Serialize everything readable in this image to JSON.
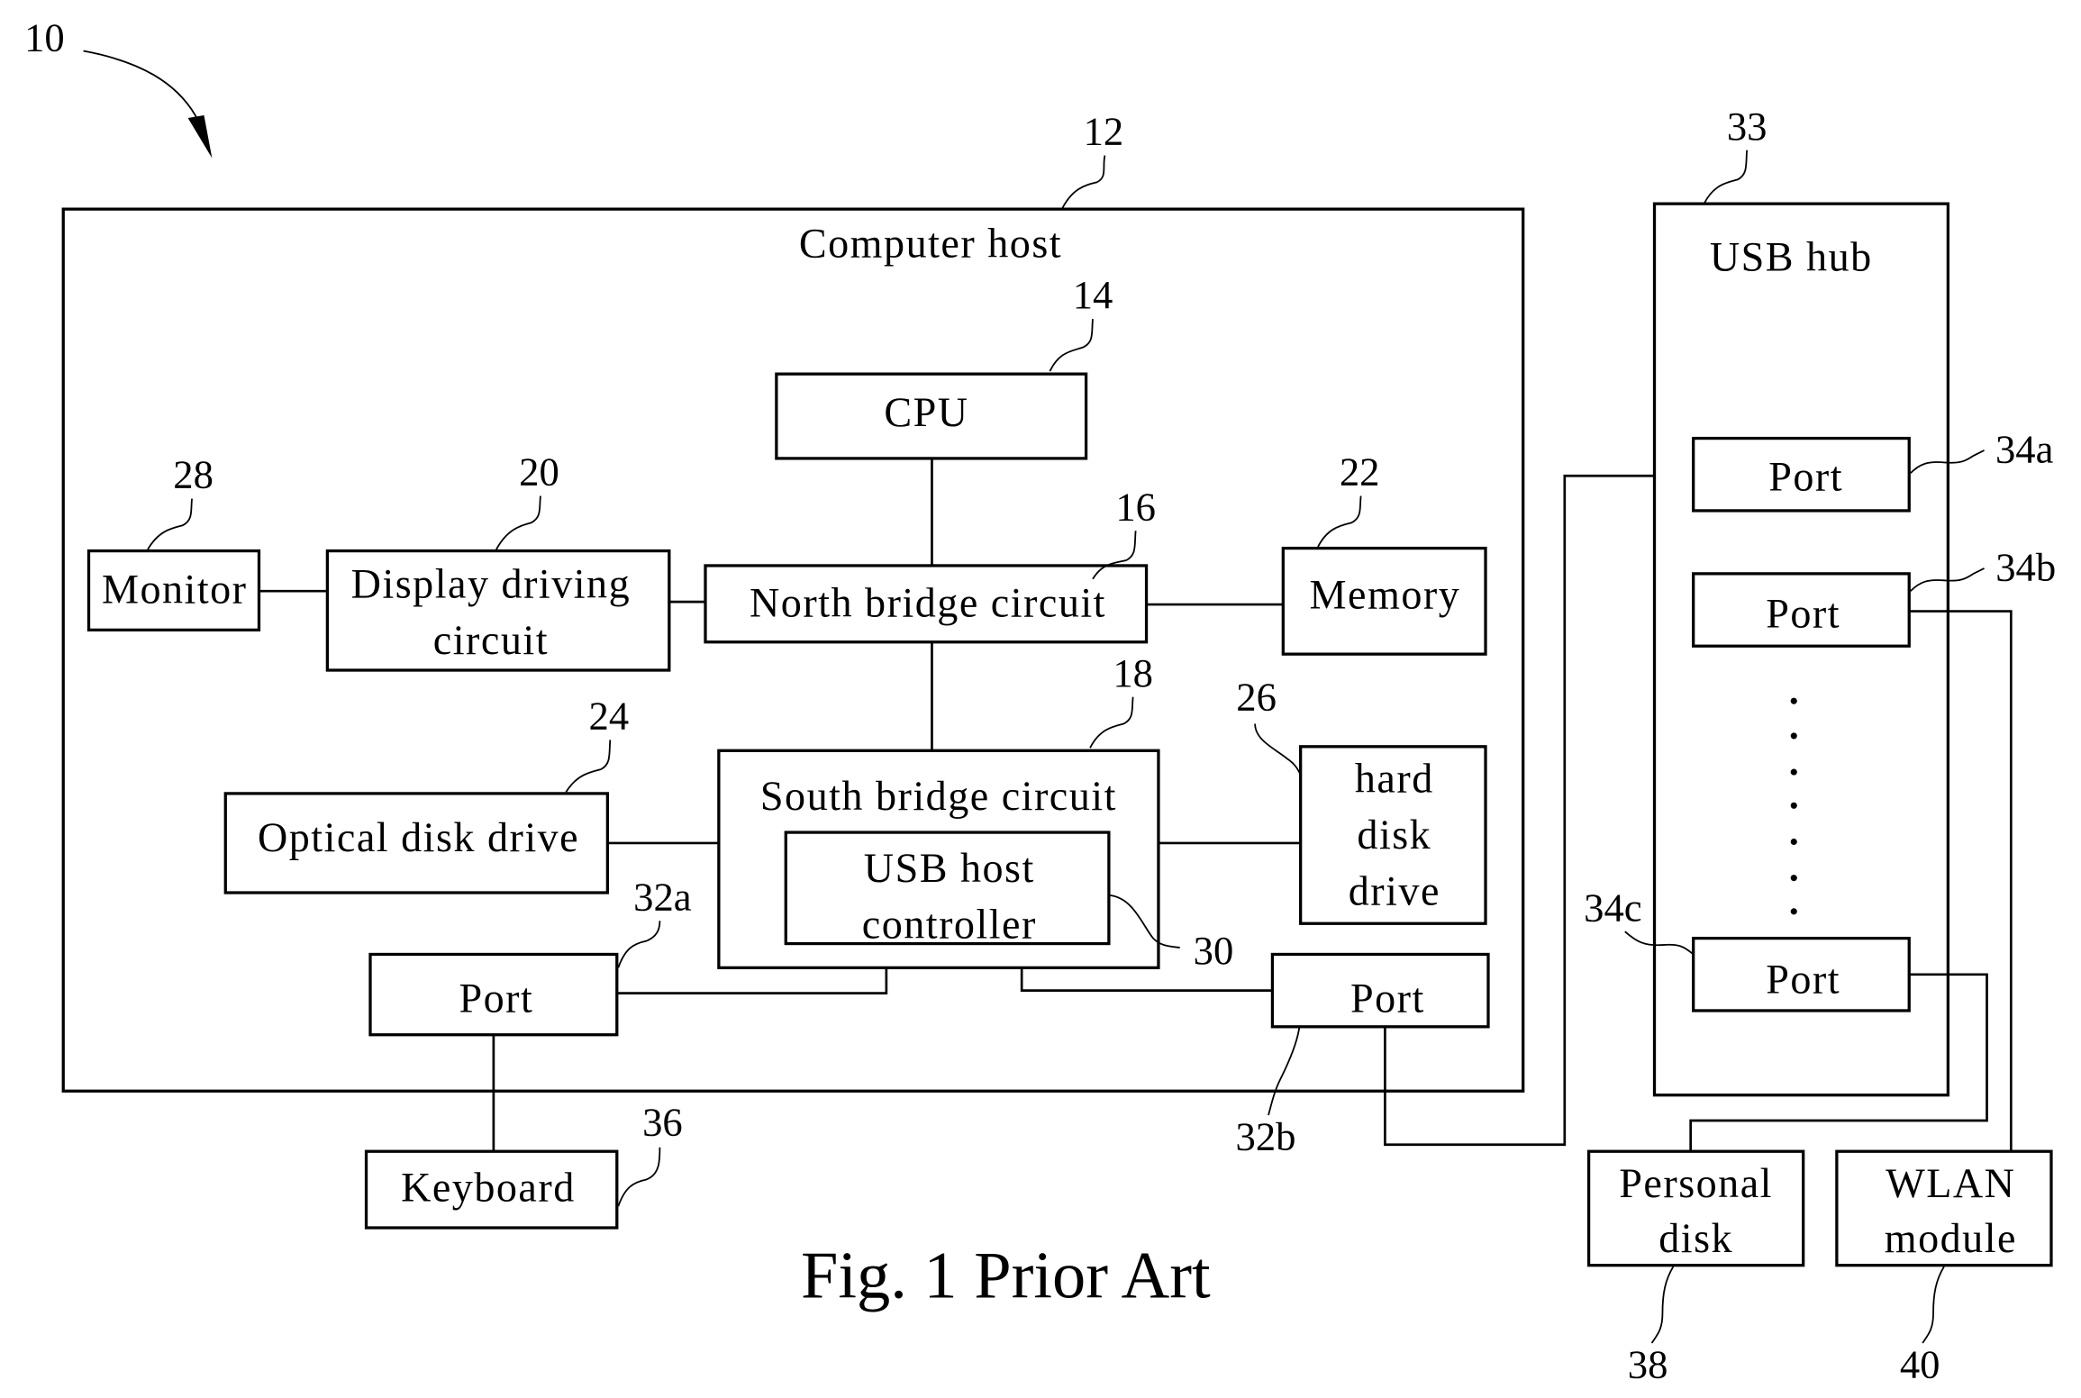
{
  "figure": {
    "caption": "Fig. 1 Prior Art",
    "system_ref": "10"
  },
  "host": {
    "ref": "12",
    "title": "Computer host",
    "cpu": {
      "ref": "14",
      "label": "CPU"
    },
    "north_bridge": {
      "ref": "16",
      "label": "North bridge circuit"
    },
    "south_bridge": {
      "ref": "18",
      "label": "South bridge circuit"
    },
    "display_driver": {
      "ref": "20",
      "lines": [
        "Display driving",
        "circuit"
      ]
    },
    "memory": {
      "ref": "22",
      "label": "Memory"
    },
    "optical_drive": {
      "ref": "24",
      "label": "Optical disk drive"
    },
    "hard_disk": {
      "ref": "26",
      "lines": [
        "hard",
        "disk",
        "drive"
      ]
    },
    "monitor": {
      "ref": "28",
      "label": "Monitor"
    },
    "usb_host_controller": {
      "ref": "30",
      "lines": [
        "USB host",
        "controller"
      ]
    },
    "port_a": {
      "ref": "32a",
      "label": "Port"
    },
    "port_b": {
      "ref": "32b",
      "label": "Port"
    }
  },
  "hub": {
    "ref": "33",
    "title": "USB hub",
    "ports": [
      {
        "ref": "34a",
        "label": "Port"
      },
      {
        "ref": "34b",
        "label": "Port"
      },
      {
        "ref": "34c",
        "label": "Port"
      }
    ]
  },
  "peripherals": {
    "keyboard": {
      "ref": "36",
      "label": "Keyboard"
    },
    "personal_disk": {
      "ref": "38",
      "lines": [
        "Personal",
        "disk"
      ]
    },
    "wlan": {
      "ref": "40",
      "lines": [
        "WLAN",
        "module"
      ]
    }
  }
}
